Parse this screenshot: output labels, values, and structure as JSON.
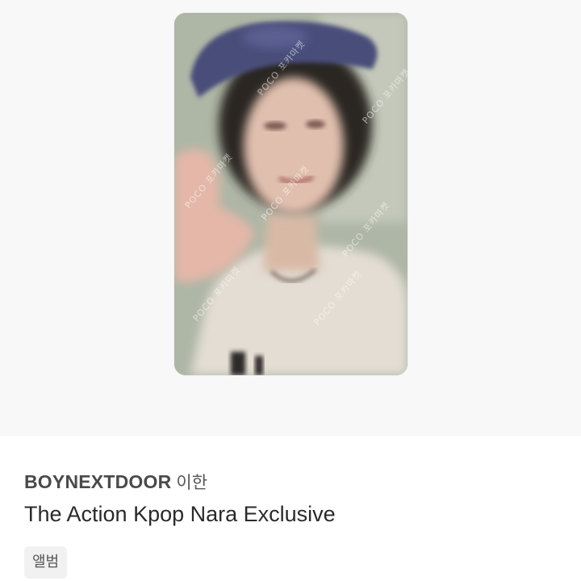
{
  "photo": {
    "alt": "BOYNEXTDOOR 이한 photocard",
    "watermark_text": "POCO 포카마켓"
  },
  "product": {
    "artist": "BOYNEXTDOOR",
    "member": "이한",
    "title": "The Action Kpop Nara Exclusive"
  },
  "tags": [
    "앨범"
  ],
  "colors": {
    "background": "#f8f8f8",
    "artist_text": "#4a4a4a",
    "title_text": "#2a2a2a",
    "tag_bg": "#f1f1f1"
  }
}
